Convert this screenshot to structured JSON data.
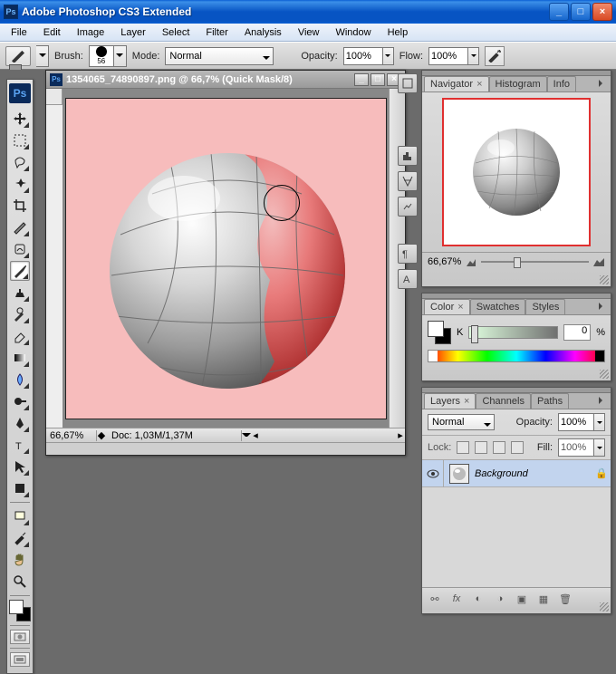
{
  "app": {
    "title": "Adobe Photoshop CS3 Extended",
    "badge": "Ps"
  },
  "menu": [
    "File",
    "Edit",
    "Image",
    "Layer",
    "Select",
    "Filter",
    "Analysis",
    "View",
    "Window",
    "Help"
  ],
  "options": {
    "brush_label": "Brush:",
    "brush_size": "56",
    "mode_label": "Mode:",
    "mode_value": "Normal",
    "opacity_label": "Opacity:",
    "opacity_value": "100%",
    "flow_label": "Flow:",
    "flow_value": "100%"
  },
  "doc": {
    "title": "1354065_74890897.png @ 66,7% (Quick Mask/8)",
    "zoom": "66,67%",
    "info": "Doc: 1,03M/1,37M"
  },
  "navigator": {
    "tabs": [
      "Navigator",
      "Histogram",
      "Info"
    ],
    "zoom": "66,67%"
  },
  "color": {
    "tabs": [
      "Color",
      "Swatches",
      "Styles"
    ],
    "k_label": "K",
    "k_value": "0",
    "k_unit": "%"
  },
  "layers": {
    "tabs": [
      "Layers",
      "Channels",
      "Paths"
    ],
    "blend": "Normal",
    "opacity_label": "Opacity:",
    "opacity_value": "100%",
    "lock_label": "Lock:",
    "fill_label": "Fill:",
    "fill_value": "100%",
    "rows": [
      {
        "name": "Background"
      }
    ]
  }
}
